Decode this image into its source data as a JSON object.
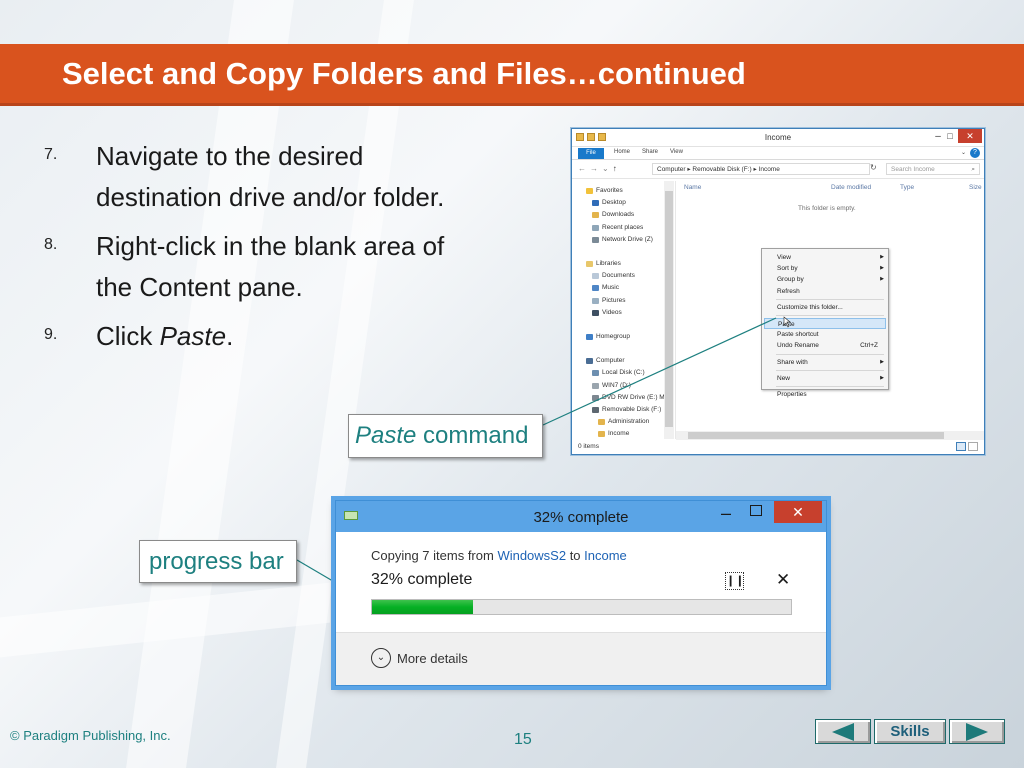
{
  "slide": {
    "title": "Select and Copy Folders and Files…continued",
    "footer_copyright": "© Paradigm Publishing, Inc.",
    "page_number": "15",
    "nav_skills_label": "Skills"
  },
  "steps": [
    {
      "num": "7.",
      "text": "Navigate to the desired destination drive and/or folder."
    },
    {
      "num": "8.",
      "text": "Right-click in the blank area of the Content pane."
    },
    {
      "num": "9.",
      "text_prefix": "Click ",
      "text_em": "Paste",
      "text_suffix": "."
    }
  ],
  "callouts": {
    "paste_em": "Paste",
    "paste_rest": " command",
    "progress": "progress bar"
  },
  "explorer": {
    "title": "Income",
    "ribbon_tabs": [
      "File",
      "Home",
      "Share",
      "View"
    ],
    "address_path": "Computer  ▸  Removable Disk (F:)  ▸  Income",
    "search_placeholder": "Search Income",
    "nav_items": {
      "favorites": "Favorites",
      "desktop": "Desktop",
      "downloads": "Downloads",
      "recent": "Recent places",
      "network_drive": "Network Drive (Z)",
      "libraries": "Libraries",
      "documents": "Documents",
      "music": "Music",
      "pictures": "Pictures",
      "videos": "Videos",
      "homegroup": "Homegroup",
      "computer": "Computer",
      "local_disk": "Local Disk (C:)",
      "win7": "WIN7 (D:)",
      "dvd": "DVD RW Drive (E:) M",
      "removable": "Removable Disk (F:)",
      "administration": "Administration",
      "income": "Income"
    },
    "columns": {
      "name": "Name",
      "date_modified": "Date modified",
      "type": "Type",
      "size": "Size"
    },
    "empty_message": "This folder is empty.",
    "status": "0 items"
  },
  "context_menu": {
    "view": "View",
    "sort_by": "Sort by",
    "group_by": "Group by",
    "refresh": "Refresh",
    "customize": "Customize this folder...",
    "paste": "Paste",
    "paste_shortcut": "Paste shortcut",
    "undo_rename": "Undo Rename",
    "undo_shortcut": "Ctrl+Z",
    "share_with": "Share with",
    "new": "New",
    "properties": "Properties"
  },
  "copy_dialog": {
    "title": "32% complete",
    "line_prefix": "Copying 7 items from ",
    "source": "WindowsS2",
    "line_mid": " to ",
    "destination": "Income",
    "percent_text": "32% complete",
    "progress_fraction": 0.24,
    "more_details": "More details"
  },
  "colors": {
    "title_bar": "#d9531e",
    "accent_teal": "#1e8080",
    "progress_green": "#06b025",
    "dialog_blue": "#5aa4e6",
    "close_red": "#c7402d"
  }
}
